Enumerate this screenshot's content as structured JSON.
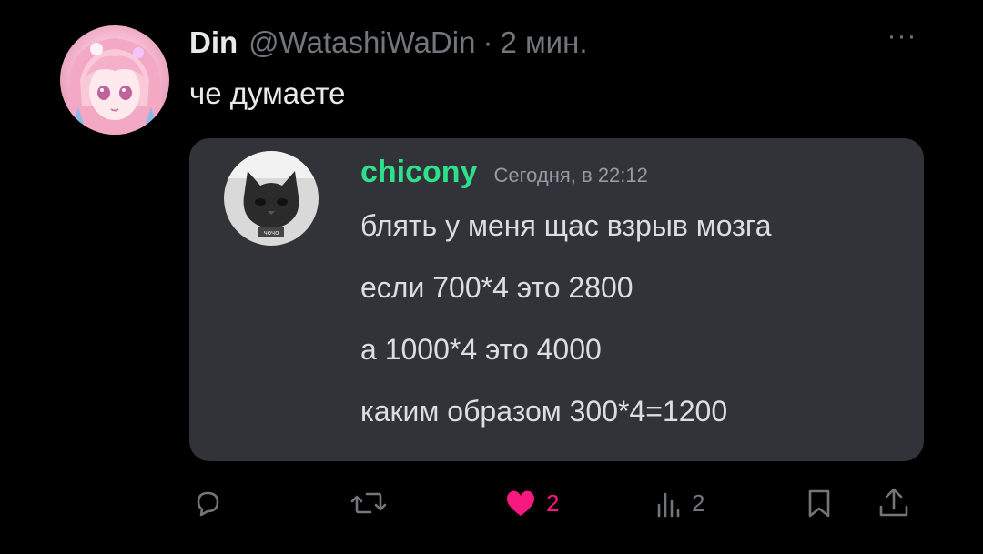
{
  "tweet": {
    "display_name": "Din",
    "handle": "@WatashiWaDin",
    "separator": "·",
    "time": "2 мин.",
    "more_label": "···",
    "text": "че думаете"
  },
  "embed": {
    "username": "chicony",
    "timestamp": "Сегодня, в 22:12",
    "lines": [
      "блять у меня щас взрыв мозга",
      "если 700*4 это 2800",
      "а 1000*4 это 4000",
      "каким образом 300*4=1200"
    ],
    "avatar_caption": "чочо"
  },
  "actions": {
    "reply_icon": "reply-icon",
    "retweet_icon": "retweet-icon",
    "like_icon": "heart-icon",
    "like_count": "2",
    "views_icon": "views-icon",
    "views_count": "2",
    "bookmark_icon": "bookmark-icon",
    "share_icon": "share-icon"
  },
  "colors": {
    "background": "#000000",
    "text": "#e7e9ea",
    "muted": "#71767b",
    "embed_bg": "#313338",
    "discord_green": "#2ee08a",
    "like_pink": "#f91880"
  }
}
